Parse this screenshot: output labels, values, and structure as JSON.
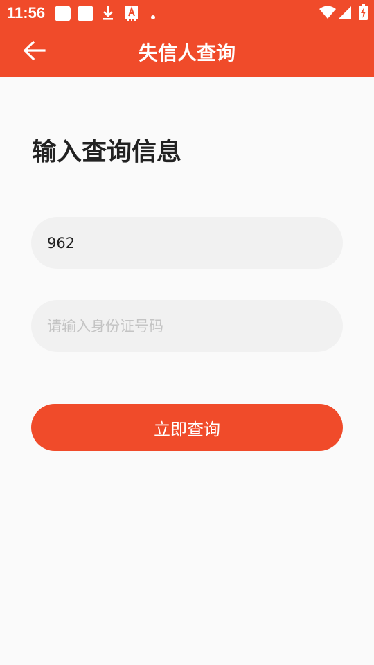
{
  "theme": {
    "accent": "#f04b2a",
    "background": "#fafafa",
    "input_bg": "#f1f1f1"
  },
  "status_bar": {
    "time": "11:56",
    "icons": [
      "notification-square-icon",
      "notification-square-icon",
      "download-icon",
      "font-app-icon",
      "more-notifications-dot-icon",
      "wifi-icon",
      "cell-signal-icon",
      "battery-charging-icon"
    ]
  },
  "app_bar": {
    "title": "失信人查询",
    "back_icon": "arrow-left-icon"
  },
  "form": {
    "heading": "输入查询信息",
    "field1": {
      "value": "962",
      "placeholder": ""
    },
    "field2": {
      "value": "",
      "placeholder": "请输入身份证号码"
    },
    "submit_label": "立即查询"
  }
}
